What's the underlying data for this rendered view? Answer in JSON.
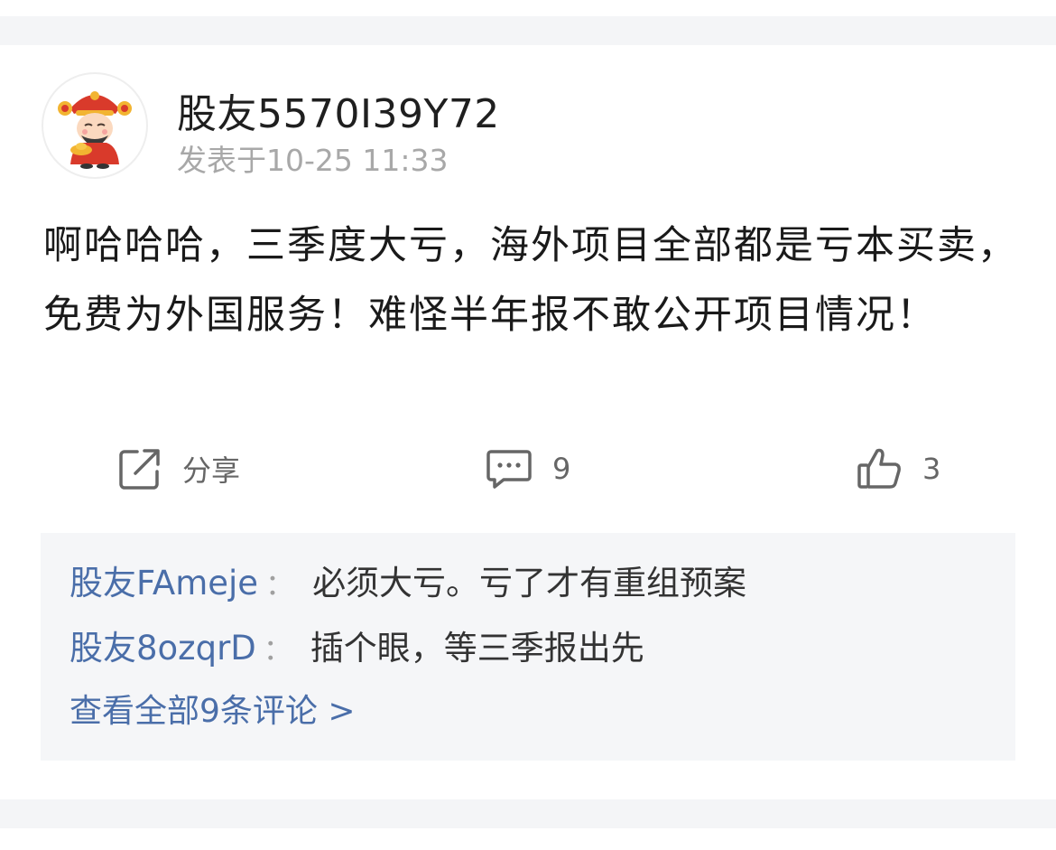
{
  "post": {
    "username": "股友5570I39Y72",
    "time": "发表于10-25 11:33",
    "text": "啊哈哈哈，三季度大亏，海外项目全部都是亏本买卖，免费为外国服务！难怪半年报不敢公开项目情况！"
  },
  "actions": {
    "share_label": "分享",
    "comment_count": "9",
    "like_count": "3"
  },
  "comments": [
    {
      "name": "股友FAmeje",
      "colon": "：",
      "text": "必须大亏。亏了才有重组预案"
    },
    {
      "name": "股友8ozqrD",
      "colon": "：",
      "text": "插个眼，等三季报出先"
    }
  ],
  "view_all_label": "查看全部9条评论 >",
  "icons": {
    "share": "share-icon",
    "comment": "comment-icon",
    "like": "thumbs-up-icon",
    "avatar": "fortune-god-avatar"
  },
  "colors": {
    "link_blue": "#4a6ea9",
    "secondary_gray": "#a8a8a8",
    "background": "#f4f5f7"
  }
}
